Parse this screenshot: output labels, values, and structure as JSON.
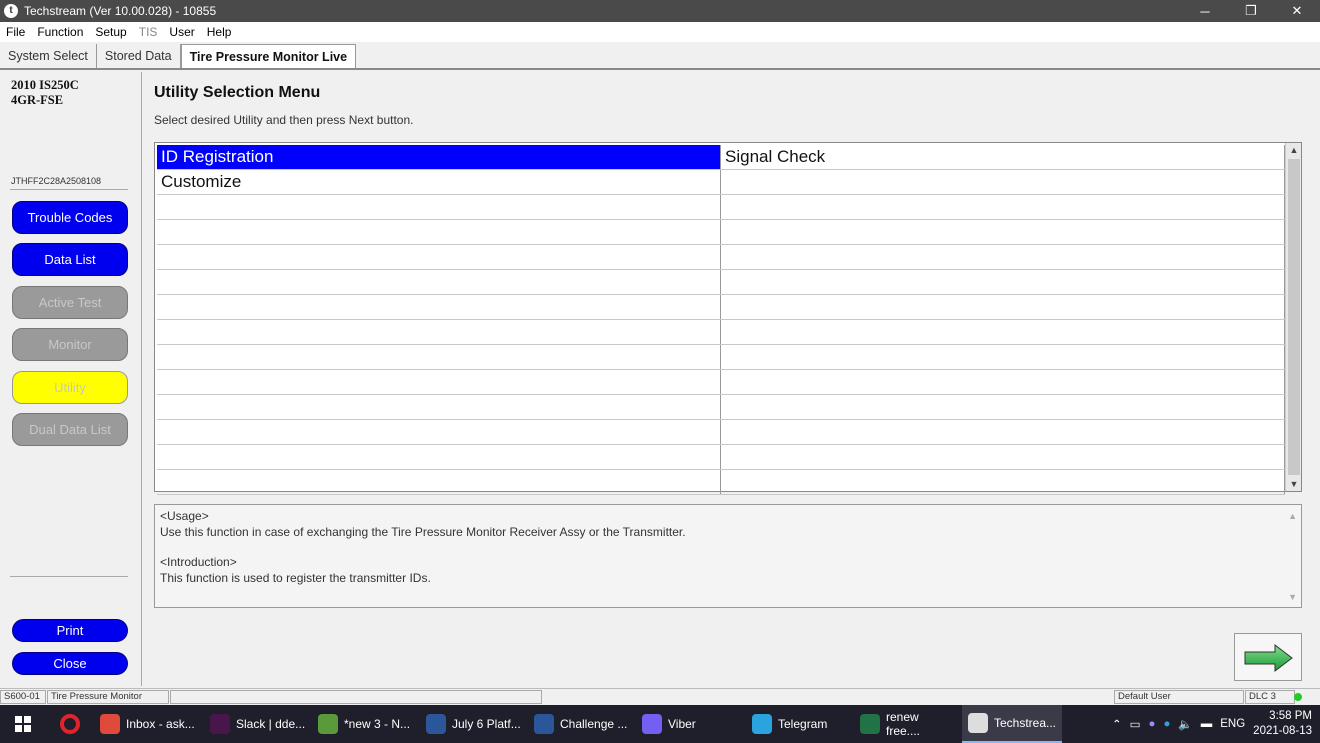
{
  "window": {
    "title": "Techstream (Ver 10.00.028) - 10855",
    "minimize": "─",
    "maximize": "❐",
    "close": "✕"
  },
  "menu": [
    "File",
    "Function",
    "Setup",
    "TIS",
    "User",
    "Help"
  ],
  "tabs": [
    "System Select",
    "Stored Data",
    "Tire Pressure Monitor Live"
  ],
  "sidebar": {
    "vehicle_line1": "2010 IS250C",
    "vehicle_line2": "4GR-FSE",
    "vin": "JTHFF2C28A2508108",
    "buttons": [
      "Trouble Codes",
      "Data List",
      "Active Test",
      "Monitor",
      "Utility",
      "Dual Data List"
    ],
    "print": "Print",
    "close": "Close"
  },
  "main": {
    "heading": "Utility Selection Menu",
    "subtitle": "Select desired Utility and then press Next button.",
    "grid": [
      [
        "ID Registration",
        "Signal Check"
      ],
      [
        "Customize",
        ""
      ]
    ],
    "usage_title": "<Usage>",
    "usage_text": "Use this function in case of exchanging the Tire Pressure Monitor Receiver Assy or the Transmitter.",
    "intro_title": "<Introduction>",
    "intro_text": "This function is used to register the transmitter IDs."
  },
  "status": {
    "code": "S600-01",
    "system": "Tire Pressure Monitor",
    "user": "Default User",
    "dlc": "DLC 3"
  },
  "taskbar": {
    "items": [
      {
        "label": "Inbox - ask...",
        "icon": "chrome-icon",
        "color": "#e04a3a"
      },
      {
        "label": "Slack | dde...",
        "icon": "slack-icon",
        "color": "#4a154b"
      },
      {
        "label": "*new 3 - N...",
        "icon": "notepad-icon",
        "color": "#5a9a3a"
      },
      {
        "label": "July 6 Platf...",
        "icon": "word-icon",
        "color": "#2b579a"
      },
      {
        "label": "Challenge ...",
        "icon": "word-icon",
        "color": "#2b579a"
      },
      {
        "label": "Viber",
        "icon": "viber-icon",
        "color": "#7360f2"
      },
      {
        "label": "Telegram",
        "icon": "telegram-icon",
        "color": "#2aa3df"
      },
      {
        "label": "renew free....",
        "icon": "excel-icon",
        "color": "#217346"
      },
      {
        "label": "Techstrea...",
        "icon": "techstream-icon",
        "color": "#dddddd"
      }
    ],
    "lang": "ENG",
    "time": "3:58 PM",
    "date": "2021-08-13"
  }
}
